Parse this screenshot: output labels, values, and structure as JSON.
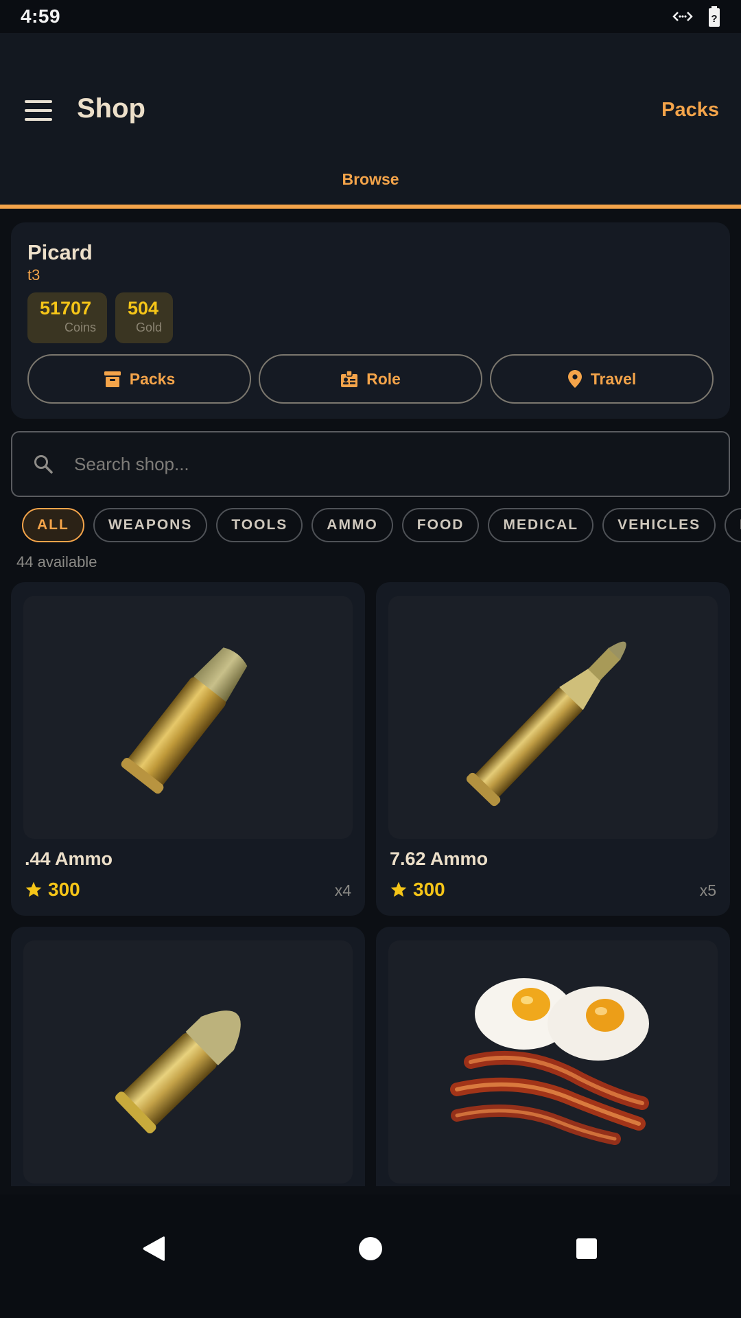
{
  "status_bar": {
    "time": "4:59"
  },
  "app_bar": {
    "title": "Shop",
    "action_label": "Packs",
    "tab_label": "Browse"
  },
  "profile": {
    "name": "Picard",
    "rank": "t3",
    "coins": {
      "value": "51707",
      "label": "Coins"
    },
    "gold": {
      "value": "504",
      "label": "Gold"
    },
    "actions": {
      "packs": "Packs",
      "role": "Role",
      "travel": "Travel"
    }
  },
  "search": {
    "placeholder": "Search shop..."
  },
  "filters": [
    "ALL",
    "WEAPONS",
    "TOOLS",
    "AMMO",
    "FOOD",
    "MEDICAL",
    "VEHICLES",
    "RES"
  ],
  "available_count": "44 available",
  "items": [
    {
      "name": ".44 Ammo",
      "price": "300",
      "qty": "x4"
    },
    {
      "name": "7.62 Ammo",
      "price": "300",
      "qty": "x5"
    },
    {
      "name": "",
      "price": "",
      "qty": ""
    },
    {
      "name": "",
      "price": "",
      "qty": ""
    }
  ],
  "colors": {
    "accent": "#f4a44a",
    "gold": "#f5c518",
    "background": "#0c0f14",
    "card": "#151a23"
  }
}
